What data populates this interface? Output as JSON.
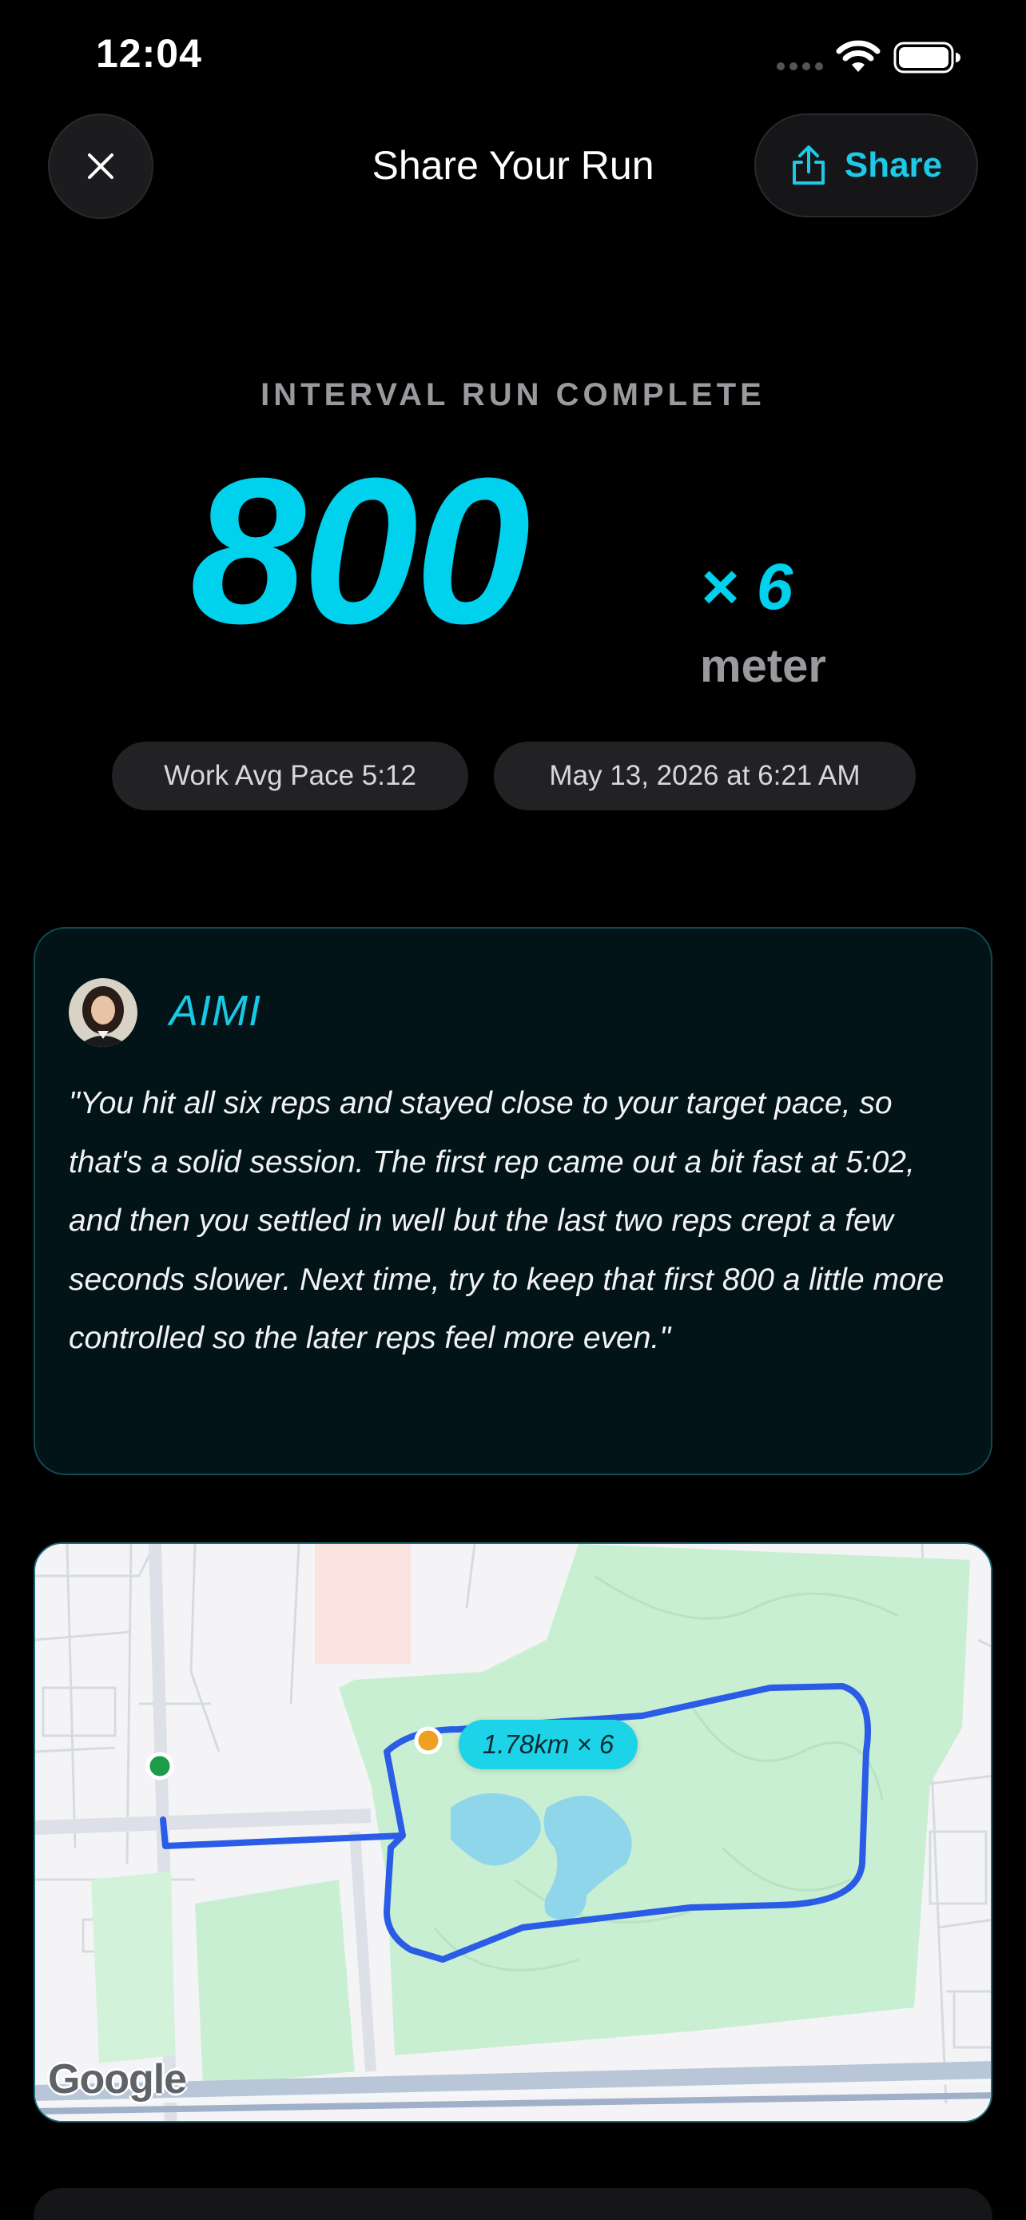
{
  "status_bar": {
    "time": "12:04"
  },
  "header": {
    "title": "Share Your Run",
    "share_label": "Share"
  },
  "summary": {
    "subtitle": "INTERVAL RUN COMPLETE",
    "distance": "800",
    "reps": "× 6",
    "unit": "meter",
    "pace_pill": "Work Avg Pace 5:12",
    "date_pill": "May 13, 2026 at 6:21 AM"
  },
  "coach": {
    "name": "AIMI",
    "quote": "\"You hit all six reps and stayed close to your target pace, so that's a solid session. The first rep came out a bit fast at 5:02, and then you settled in well but the last two reps crept a few seconds slower. Next time, try to keep that first 800 a little more controlled so the later reps feel more even.\""
  },
  "map": {
    "route_label": "1.78km × 6",
    "attribution": "Google",
    "colors": {
      "route": "#2a5ce6",
      "start": "#1d9a4a",
      "end": "#f0a020",
      "park": "#c9efd3",
      "water": "#8fd6ea"
    }
  },
  "colors": {
    "accent": "#00d1ec",
    "background": "#000000"
  },
  "icons": {
    "close": "close-icon",
    "share": "share-icon",
    "wifi": "wifi-icon",
    "battery": "battery-icon"
  }
}
